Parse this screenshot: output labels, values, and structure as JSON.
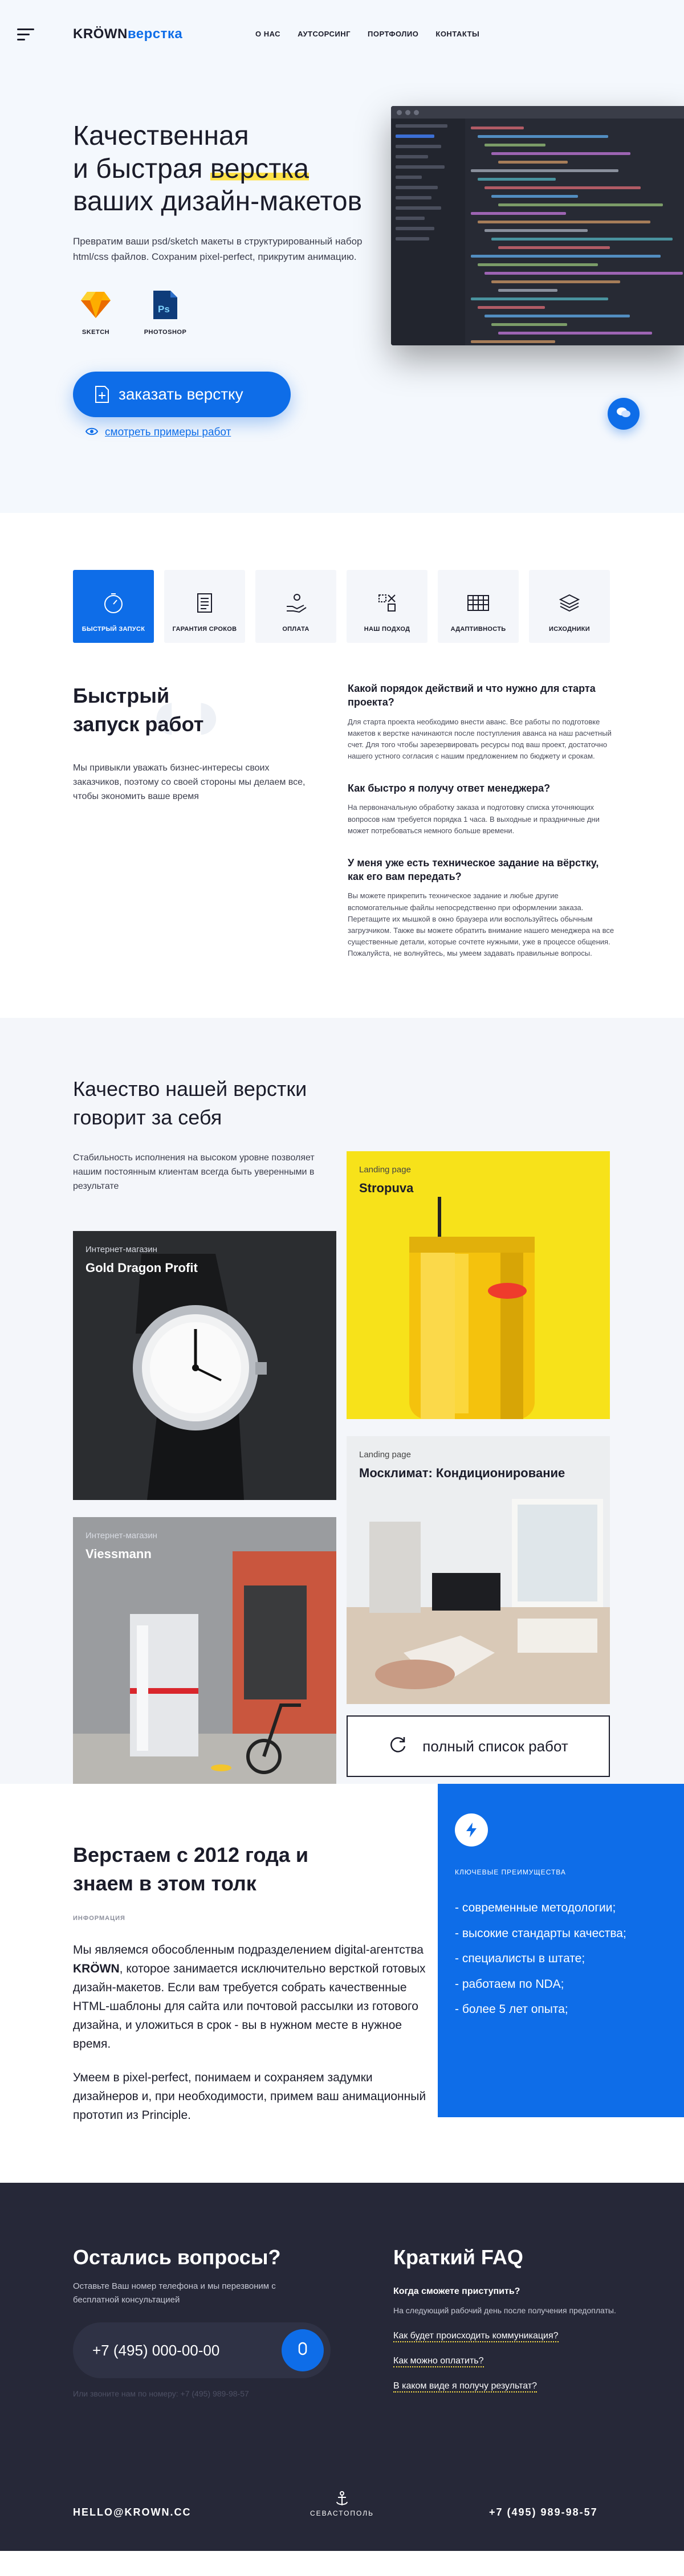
{
  "header": {
    "logo_part1": "KRÖWN",
    "logo_part2": "верстка",
    "nav": [
      "О НАС",
      "АУТСОРСИНГ",
      "ПОРТФОЛИО",
      "КОНТАКТЫ"
    ]
  },
  "hero": {
    "title_line1": "Качественная",
    "title_line2_pre": "и быстрая ",
    "title_line2_hl": "верстка",
    "title_line3": "ваших дизайн-макетов",
    "subtitle": "Превратим ваши psd/sketch макеты в структурированный набор html/css файлов. Сохраним pixel-perfect, прикрутим анимацию.",
    "tools": [
      {
        "label": "SKETCH",
        "icon": "sketch-icon"
      },
      {
        "label": "PHOTOSHOP",
        "icon": "photoshop-icon"
      }
    ],
    "cta": "заказать верстку",
    "examples_link": "смотреть примеры работ",
    "accent": "#0e6de8"
  },
  "features": {
    "cards": [
      {
        "label": "БЫСТРЫЙ ЗАПУСК",
        "icon": "stopwatch-icon"
      },
      {
        "label": "ГАРАНТИЯ СРОКОВ",
        "icon": "document-icon"
      },
      {
        "label": "ОПЛАТА",
        "icon": "hand-coin-icon"
      },
      {
        "label": "НАШ ПОДХОД",
        "icon": "layout-icon"
      },
      {
        "label": "АДАПТИВНОСТЬ",
        "icon": "keyboard-icon"
      },
      {
        "label": "ИСХОДНИКИ",
        "icon": "layers-icon"
      }
    ],
    "title_line1": "Быстрый",
    "title_line2": "запуск работ",
    "text": "Мы привыкли уважать бизнес-интересы своих заказчиков, поэтому со своей стороны мы делаем все, чтобы экономить ваше время",
    "faq": [
      {
        "q": "Какой порядок действий и что нужно для старта проекта?",
        "a": "Для старта проекта необходимо внести аванс. Все работы по подготовке макетов к верстке начинаются после поступления аванса на наш расчетный счет. Для того чтобы зарезервировать ресурсы под ваш проект, достаточно нашего устного согласия с нашим предложением по бюджету и срокам."
      },
      {
        "q": "Как быстро я получу ответ менеджера?",
        "a": "На первоначальную обработку заказа и подготовку списка уточняющих вопросов нам требуется порядка 1 часа. В выходные и праздничные дни может потребоваться немного больше времени."
      },
      {
        "q": "У меня уже есть техническое задание на вёрстку, как его вам передать?",
        "a": "Вы можете прикрепить техническое задание и любые другие вспомогательные файлы непосредственно при оформлении заказа. Перетащите их мышкой в окно браузера или воспользуйтесь обычным загрузчиком. Также вы можете обратить внимание нашего менеджера на все существенные детали, которые сочтете нужными, уже в процессе общения. Пожалуйста, не волнуйтесь, мы умеем задавать правильные вопросы."
      }
    ]
  },
  "portfolio": {
    "title": "Качество нашей верстки говорит за себя",
    "subtitle": "Стабильность исполнения на высоком уровне позволяет нашим постоянным клиентам всегда быть уверенными в результате",
    "items": [
      {
        "tag": "Landing page",
        "name": "Stropuva"
      },
      {
        "tag": "Интернет-магазин",
        "name": "Gold Dragon Profit"
      },
      {
        "tag": "Landing page",
        "name": "Москлимат: Кондиционирование"
      },
      {
        "tag": "Интернет-магазин",
        "name": "Viessmann"
      }
    ],
    "all_button": "полный список работ"
  },
  "about": {
    "title": "Верстаем с 2012 года и знаем в этом толк",
    "info_label": "ИНФОРМАЦИЯ",
    "para1_pre": "Мы являемся обособленным подразделением digital-агентства ",
    "para1_brand": "KRÖWN",
    "para1_post": ", которое занимается исключительно версткой готовых дизайн-макетов. Если вам требуется собрать качественные HTML-шаблоны для сайта или почтовой рассылки из готового дизайна, и уложиться в срок - вы в нужном месте в нужное время.",
    "para2": "Умеем в pixel-perfect, понимаем и сохраняем задумки дизайнеров и, при необходимости, примем ваш анимационный прототип из Principle.",
    "advantages_label": "КЛЮЧЕВЫЕ ПРЕИМУЩЕСТВА",
    "advantages": [
      "- современные методологии;",
      "- высокие стандарты качества;",
      "- специалисты в штате;",
      "- работаем по NDA;",
      "- более 5 лет опыта;"
    ]
  },
  "contact": {
    "title": "Остались вопросы?",
    "subtitle": "Оставьте Ваш номер телефона и мы перезвоним с бесплатной консультацией",
    "phone_value": "+7 (495) 000-00-00",
    "call_hint": "Или звоните нам по номеру: +7 (495) 989-98-57",
    "faq_title": "Краткий FAQ",
    "faq_q": "Когда сможете приступить?",
    "faq_a": "На следующий рабочий день после получения предоплаты.",
    "faq_links": [
      "Как будет происходить коммуникация?",
      "Как можно оплатить?",
      "В каком виде я получу результат?"
    ]
  },
  "footer": {
    "email": "HELLO@KROWN.CC",
    "city": "СЕВАСТОПОЛЬ",
    "phone": "+7 (495) 989-98-57"
  }
}
